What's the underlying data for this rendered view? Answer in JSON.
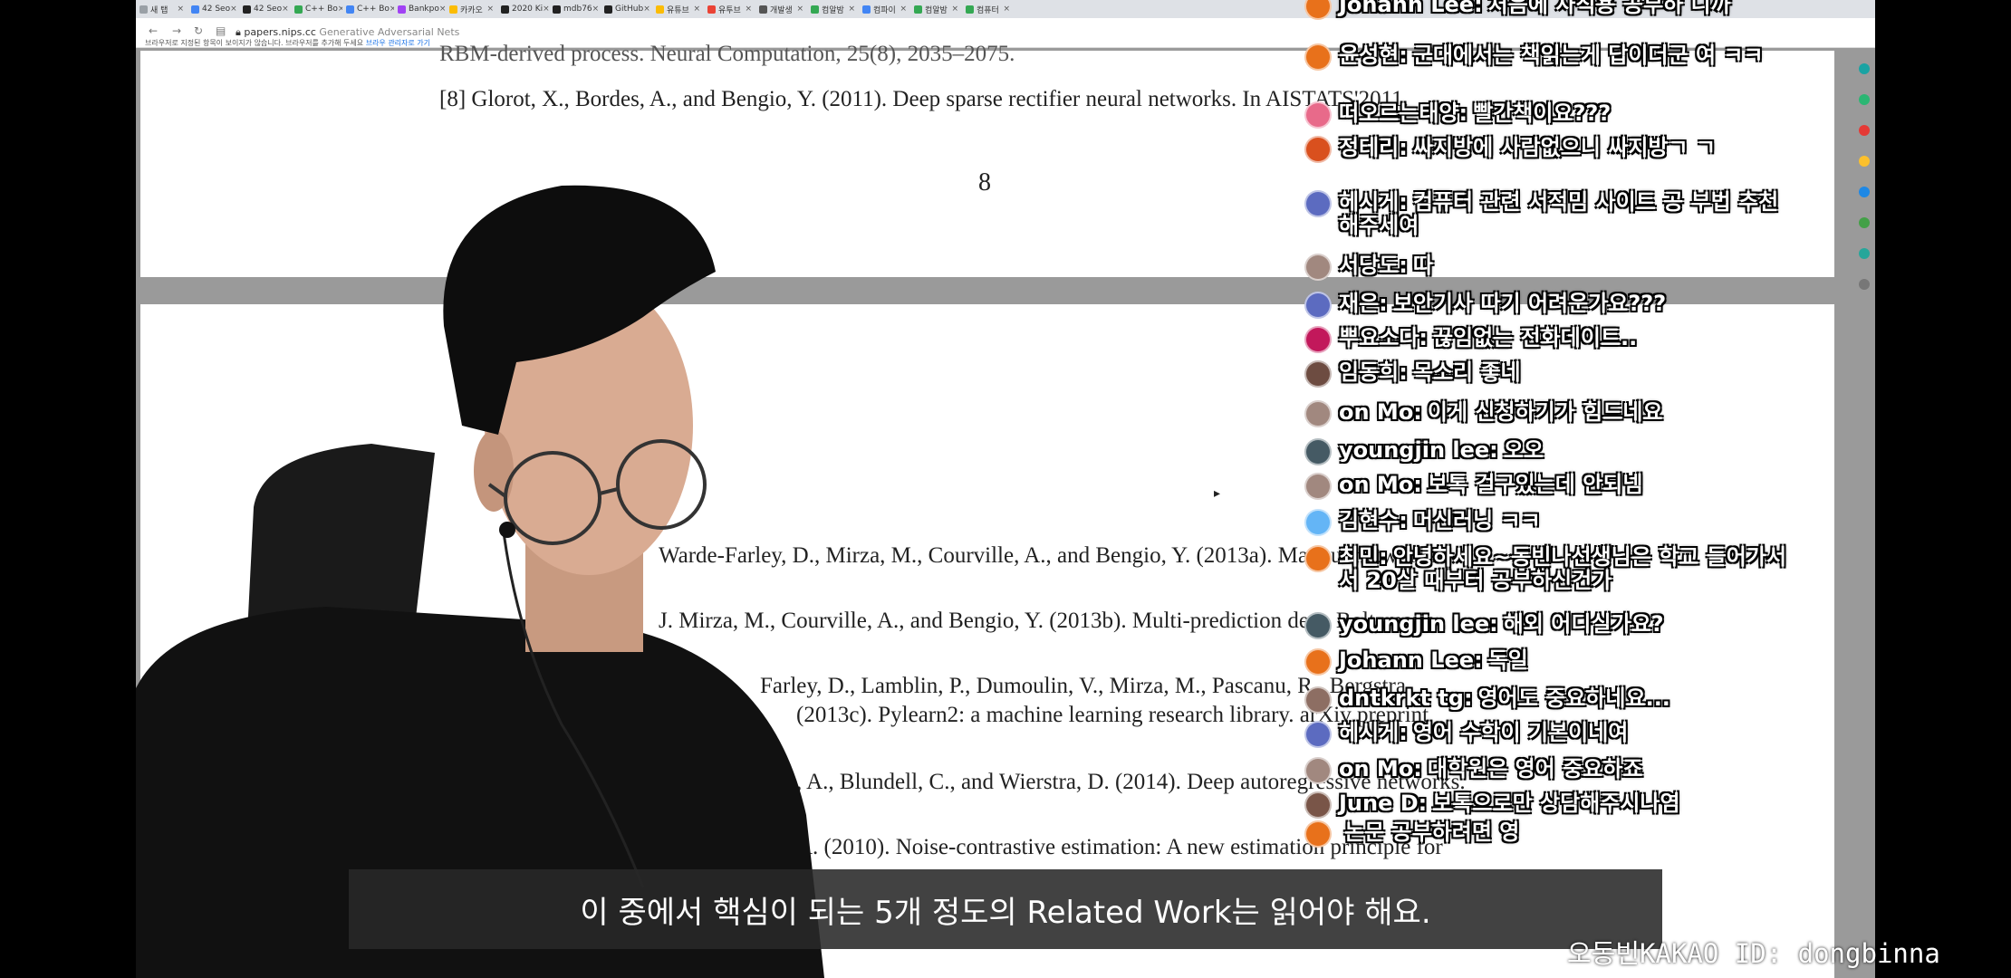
{
  "browser": {
    "tabs": [
      {
        "label": "새 탭",
        "color": "#9aa0a6"
      },
      {
        "label": "42 Seo",
        "color": "#4285f4"
      },
      {
        "label": "42 Seo",
        "color": "#222222"
      },
      {
        "label": "C++ Bo",
        "color": "#34a853"
      },
      {
        "label": "C++ Bo",
        "color": "#4285f4"
      },
      {
        "label": "Bankpo",
        "color": "#a142f4"
      },
      {
        "label": "카카오",
        "color": "#fbbc04"
      },
      {
        "label": "2020 Ki",
        "color": "#222222"
      },
      {
        "label": "mdb76",
        "color": "#222222"
      },
      {
        "label": "GitHub",
        "color": "#222222"
      },
      {
        "label": "유튜브",
        "color": "#fbbc04"
      },
      {
        "label": "유투브",
        "color": "#ea4335"
      },
      {
        "label": "개발생",
        "color": "#555555"
      },
      {
        "label": "컴알밤",
        "color": "#34a853"
      },
      {
        "label": "컴파이",
        "color": "#4285f4"
      },
      {
        "label": "컴알밤",
        "color": "#34a853"
      },
      {
        "label": "컴퓨터",
        "color": "#34a853"
      }
    ],
    "url_host": "papers.nips.cc",
    "url_title": "Generative Adversarial Nets",
    "info_text": "브라우저로 지정된 항목이 보이지가 않습니다. 브라우저를 추가해 두세요",
    "info_link": "브라우 관리자로 가기"
  },
  "pdf": {
    "top_fragment": "RBM-derived process. Neural Computation, 25(8), 2035–2075.",
    "ref8": "[8]  Glorot, X., Bordes, A., and Bengio, Y. (2011).  Deep sparse rectifier neural networks.  In AISTATS'2011.",
    "page_number": "8",
    "refs": [
      "Warde-Farley, D., Mirza, M., Courville, A., and Bengio, Y. (2013a).  Maxout networks.",
      "J.  Mirza, M., Courville, A., and Bengio, Y. (2013b).  Multi-prediction deep Boltzmann",
      "Farley, D., Lamblin, P., Dumoulin, V., Mirza, M., Pascanu, R., Bergstra,",
      "(2013c).  Pylearn2: a machine learning research library.  arXiv preprint",
      ", A., Blundell, C., and Wierstra, D. (2014).  Deep autoregressive networks.",
      "A. (2010).  Noise-contrastive estimation: A new estimation principle for"
    ]
  },
  "chat": [
    {
      "author": "Johann Lee:",
      "text": "처음에 사직용 공부하 니까",
      "color": "#e8711b"
    },
    {
      "author": "윤성현:",
      "text": "군대에서는 책읽는게 답이더군 여 ㅋㅋ",
      "color": "#e8711b"
    },
    {
      "author": "떠오르는태양:",
      "text": "빨간책이요???",
      "color": "#e86a8a"
    },
    {
      "author": "정테리:",
      "text": "싸지방에 사람없으니 싸지방ㄱ ㄱ",
      "color": "#d9501e"
    },
    {
      "author": "헤시게:",
      "text": "컴퓨터 관련 서적밈 사이트 공 부법 추천해주세여",
      "color": "#5c6bc0"
    },
    {
      "author": "서당도:",
      "text": "따",
      "color": "#a1887f"
    },
    {
      "author": "재은:",
      "text": "보안기사 따기 어려운가요???",
      "color": "#5c6bc0"
    },
    {
      "author": "뿌요소다:",
      "text": "끊임없는 전화데이트..",
      "color": "#c2185b"
    },
    {
      "author": "임동희:",
      "text": "목소리 좋네",
      "color": "#6d4c41"
    },
    {
      "author": "on Mo:",
      "text": "이게 신청하기가 힘드네요",
      "color": "#a1887f"
    },
    {
      "author": "youngjin lee:",
      "text": "오오",
      "color": "#455a64"
    },
    {
      "author": "on Mo:",
      "text": "보톡 걸구있는데 안되넴",
      "color": "#a1887f"
    },
    {
      "author": "김현수:",
      "text": "머신러닝 ㅋㅋ",
      "color": "#64b5f6"
    },
    {
      "author": "최민:",
      "text": "안녕하세요~동빈나선생님은 학교 들어가서서 20살 때부터 공부하신건가",
      "color": "#e8711b"
    },
    {
      "author": "youngjin lee:",
      "text": "해외 어디실가요?",
      "color": "#455a64"
    },
    {
      "author": "Johann Lee:",
      "text": "독일",
      "color": "#e8711b"
    },
    {
      "author": "dntkrkt tg:",
      "text": "영어도 중요하네요...",
      "color": "#8d6e63"
    },
    {
      "author": "헤시게:",
      "text": "영어 수학이 기본이네여",
      "color": "#5c6bc0"
    },
    {
      "author": "on Mo:",
      "text": "대학원은 영어 중요하죠",
      "color": "#a1887f"
    },
    {
      "author": "June D:",
      "text": "보톡으로만 상담해주시나염",
      "color": "#795548"
    },
    {
      "author": "",
      "text": "논문 공부하려면 영",
      "color": "#e8711b"
    }
  ],
  "subtitle": "이 중에서 핵심이 되는 5개 정도의 Related Work는 읽어야 해요.",
  "kakao_id": "KAKAO ID: dongbinna",
  "kakao_prefix": "오동빈"
}
